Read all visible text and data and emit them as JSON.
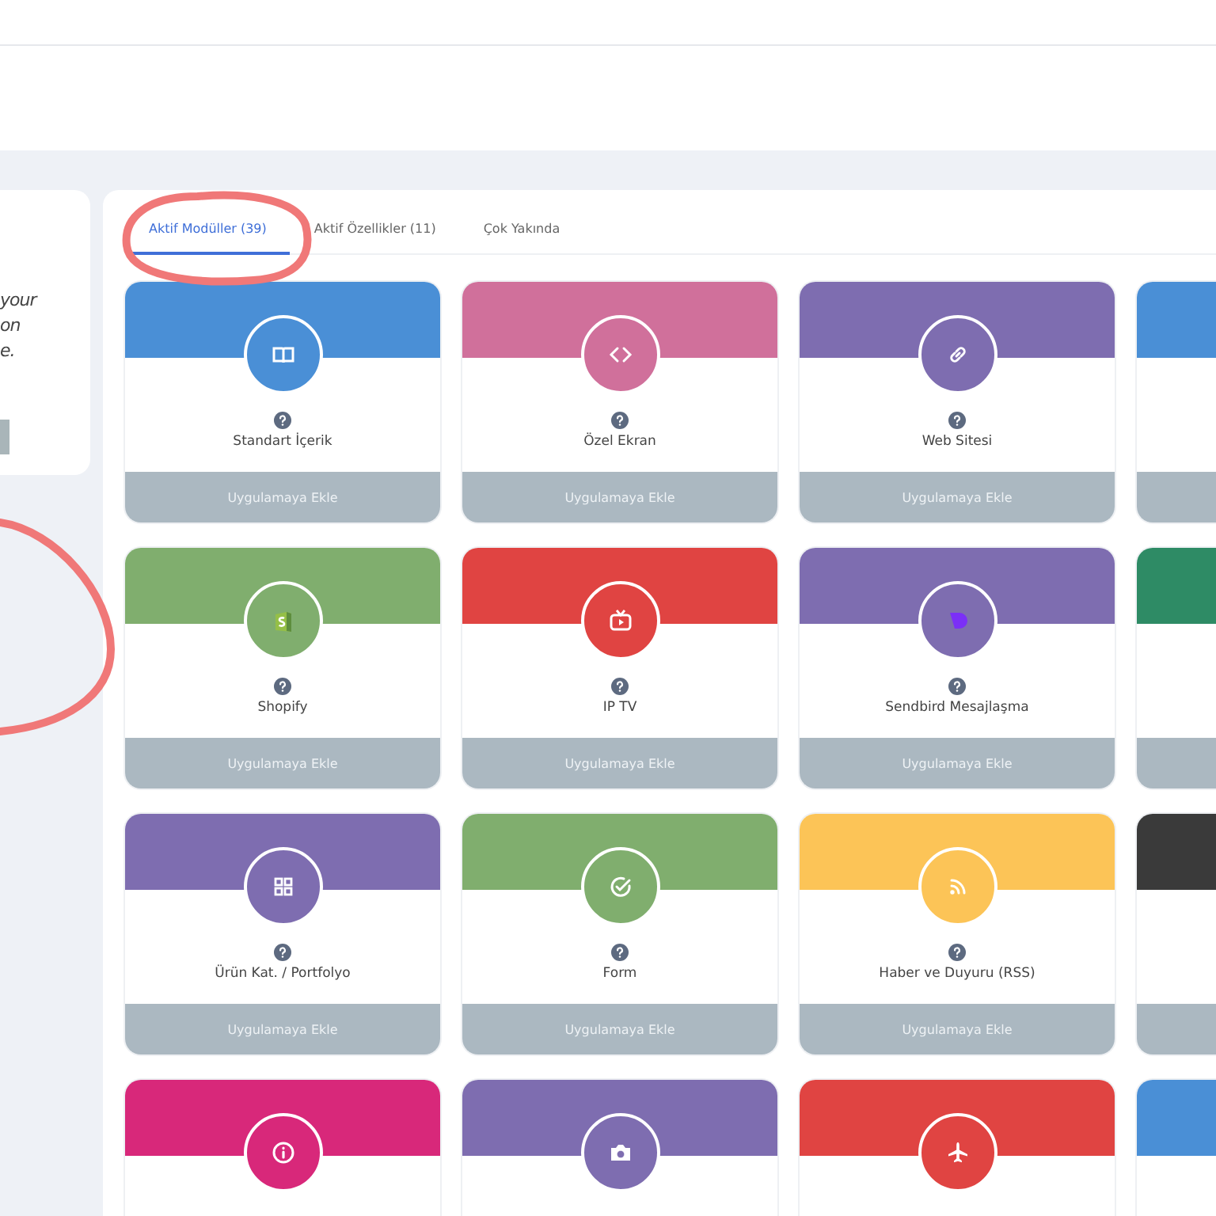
{
  "side_card": {
    "note": "your\non\ne."
  },
  "tabs": [
    {
      "label": "Aktif Modüller (39)",
      "selected": true
    },
    {
      "label": "Aktif Özellikler (11)",
      "selected": false
    },
    {
      "label": "Çok Yakında",
      "selected": false
    }
  ],
  "rows": [
    {
      "cards": [
        {
          "name": "Standart İçerik",
          "color": "#4a8fd6",
          "button": "Uygulamaya Ekle"
        },
        {
          "name": "Özel Ekran",
          "color": "#d0709b",
          "button": "Uygulamaya Ekle"
        },
        {
          "name": "Web Sitesi",
          "color": "#7e6db0",
          "button": "Uygulamaya Ekle"
        },
        {
          "color": "#4a8fd6"
        }
      ]
    },
    {
      "cards": [
        {
          "name": "Shopify",
          "color": "#80ae6e",
          "button": "Uygulamaya Ekle"
        },
        {
          "name": "IP TV",
          "color": "#e04442",
          "button": "Uygulamaya Ekle"
        },
        {
          "name": "Sendbird Mesajlaşma",
          "color": "#7e6db0",
          "button": "Uygulamaya Ekle"
        },
        {
          "color": "#2e8b65"
        }
      ]
    },
    {
      "cards": [
        {
          "name": "Ürün Kat. / Portfolyo",
          "color": "#7e6db0",
          "button": "Uygulamaya Ekle"
        },
        {
          "name": "Form",
          "color": "#80ae6e",
          "button": "Uygulamaya Ekle"
        },
        {
          "name": "Haber ve Duyuru (RSS)",
          "color": "#fcc457",
          "button": "Uygulamaya Ekle"
        },
        {
          "color": "#3a3a3a"
        }
      ]
    },
    {
      "cards": [
        {
          "color": "#d8287a"
        },
        {
          "color": "#7e6db0"
        },
        {
          "color": "#e04442"
        },
        {
          "color": "#4a8fd6"
        }
      ]
    }
  ]
}
